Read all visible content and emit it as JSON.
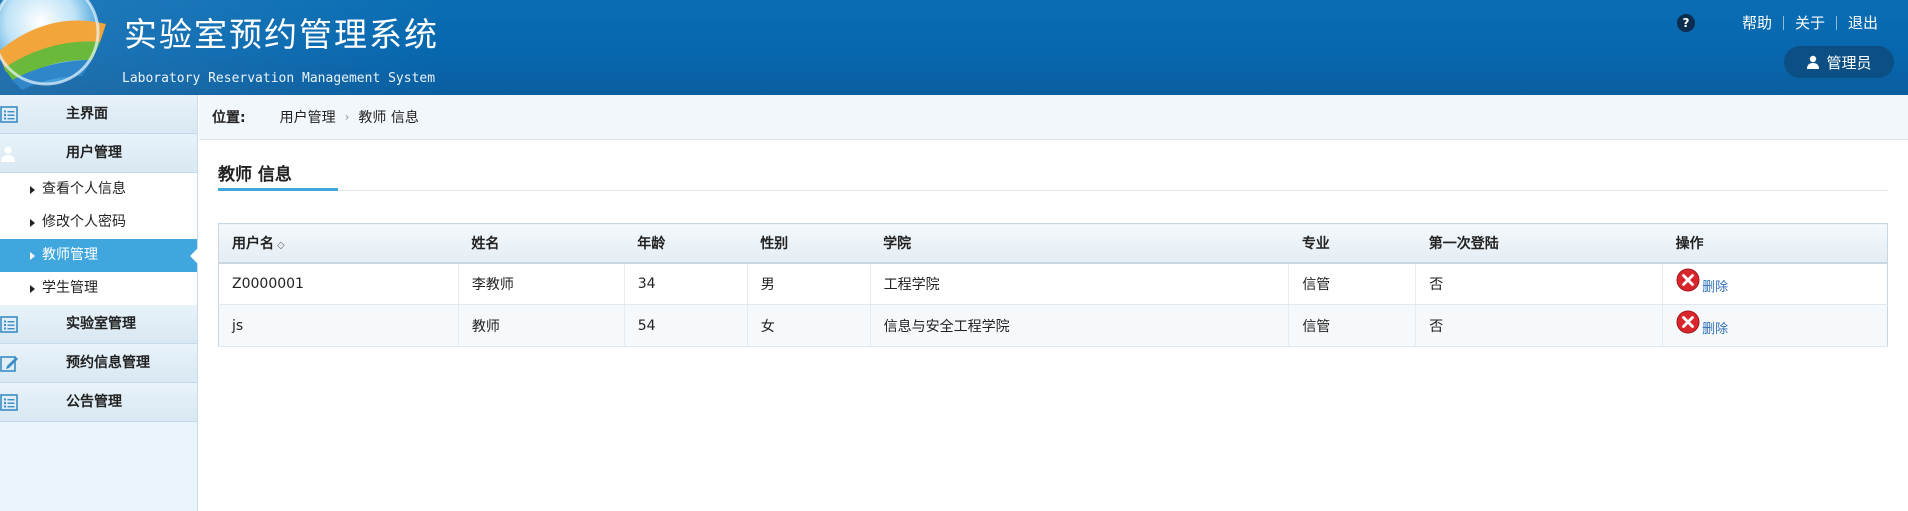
{
  "header": {
    "title": "实验室预约管理系统",
    "subtitle": "Laboratory Reservation Management System",
    "help_glyph": "?",
    "links": [
      "帮助",
      "关于",
      "退出"
    ],
    "user": "管理员"
  },
  "sidebar": {
    "home": "主界面",
    "user_mgmt": "用户管理",
    "sub_items": [
      "查看个人信息",
      "修改个人密码",
      "教师管理",
      "学生管理"
    ],
    "lab_mgmt": "实验室管理",
    "booking_mgmt": "预约信息管理",
    "notice_mgmt": "公告管理"
  },
  "breadcrumb": {
    "label": "位置:",
    "path": [
      "用户管理",
      "教师 信息"
    ]
  },
  "content": {
    "title": "教师 信息"
  },
  "table": {
    "columns": [
      "用户名",
      "姓名",
      "年龄",
      "性别",
      "学院",
      "专业",
      "第一次登陆",
      "操作"
    ],
    "sort_glyph": "◇",
    "rows": [
      {
        "username": "Z0000001",
        "name": "李教师",
        "age": "34",
        "gender": "男",
        "college": "工程学院",
        "major": "信管",
        "first_login": "否",
        "action": "删除"
      },
      {
        "username": "js",
        "name": "教师",
        "age": "54",
        "gender": "女",
        "college": "信息与安全工程学院",
        "major": "信管",
        "first_login": "否",
        "action": "删除"
      }
    ]
  },
  "icons": {
    "logo": "globe-logo-icon",
    "help": "help-icon",
    "user": "user-icon",
    "menu": "list-icon",
    "edit": "edit-icon",
    "delete": "delete-circle-icon"
  },
  "colors": {
    "header_blue": "#0767ae",
    "active_blue": "#3fa7de",
    "delete_red": "#d9262c"
  }
}
